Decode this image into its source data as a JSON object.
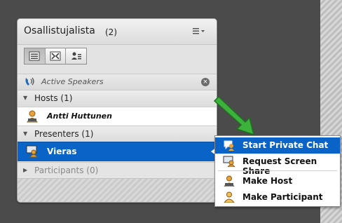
{
  "pod": {
    "title": "Osallistujalista",
    "count": "(2)",
    "menu_icon": "options-menu-icon"
  },
  "view_buttons": [
    "list-view-icon",
    "grid-view-icon",
    "attendee-status-icon"
  ],
  "active_speakers": "Active Speakers",
  "groups": {
    "hosts": "Hosts (1)",
    "presenters": "Presenters (1)",
    "participants": "Participants (0)"
  },
  "users": {
    "host": "Antti Huttunen",
    "presenter": "Vieras"
  },
  "context_menu": {
    "items": [
      {
        "label": "Start Private Chat",
        "icon": "chat-icon"
      },
      {
        "label": "Request Screen Share",
        "icon": "screen-share-icon"
      },
      {
        "label": "Make Host",
        "icon": "host-user-icon"
      },
      {
        "label": "Make Participant",
        "icon": "participant-user-icon"
      }
    ]
  },
  "colors": {
    "selection": "#0a63c6",
    "arrow": "#2fa12f"
  }
}
